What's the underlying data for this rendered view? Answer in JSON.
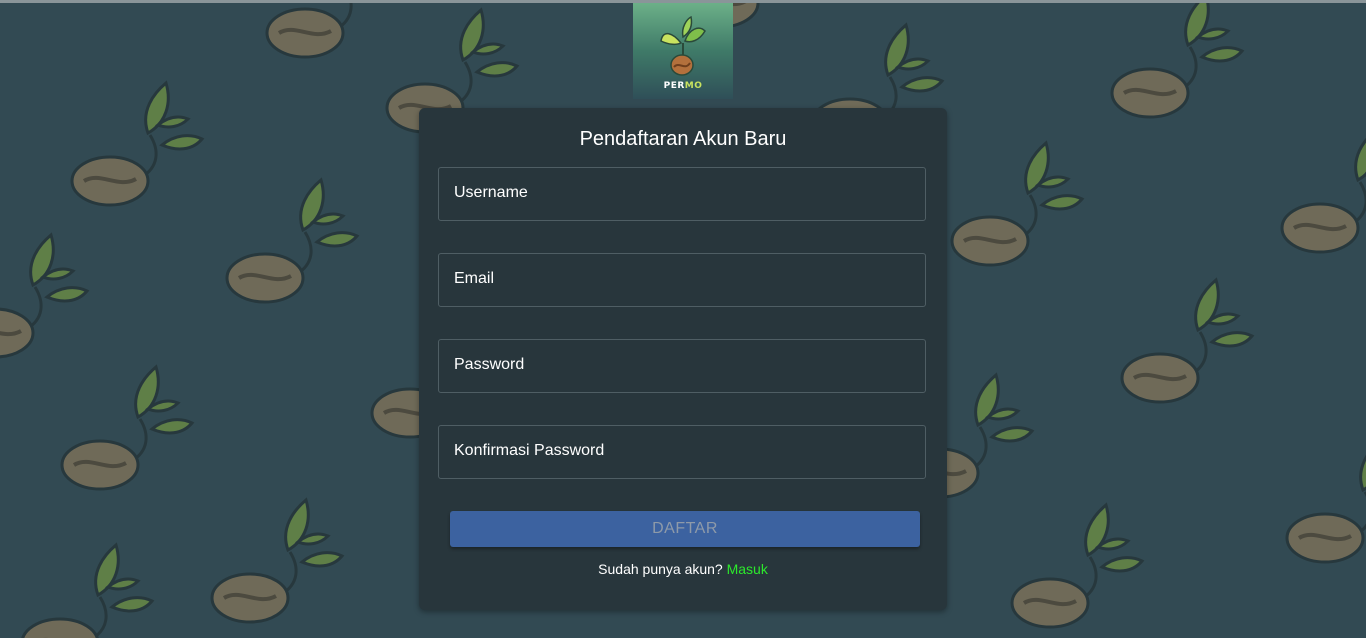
{
  "logo": {
    "brand_part1": "PER",
    "brand_part2": "MO",
    "icon": "sprouting-bean-logo"
  },
  "form": {
    "title": "Pendaftaran Akun Baru",
    "fields": [
      {
        "placeholder": "Username"
      },
      {
        "placeholder": "Email"
      },
      {
        "placeholder": "Password"
      },
      {
        "placeholder": "Konfirmasi Password"
      }
    ],
    "submit_label": "DAFTAR",
    "signin_prompt": "Sudah punya akun?",
    "signin_link": "Masuk"
  },
  "background": {
    "pattern_icon": "coffee-bean-sprout-icon"
  },
  "colors": {
    "page_bg": "#324a53",
    "card_bg": "#28363c",
    "button_bg": "#3c62a0",
    "link": "#2ce82c",
    "leaf": "#5f7f47",
    "bean": "#6f6a58"
  }
}
